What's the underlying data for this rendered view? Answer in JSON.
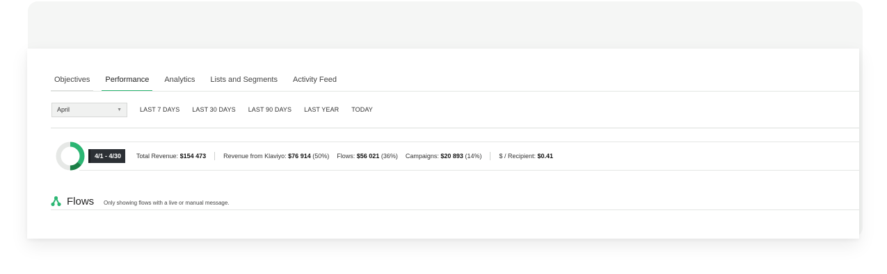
{
  "tabs": [
    {
      "label": "Objectives",
      "active": false
    },
    {
      "label": "Performance",
      "active": true
    },
    {
      "label": "Analytics",
      "active": false
    },
    {
      "label": "Lists and Segments",
      "active": false
    },
    {
      "label": "Activity Feed",
      "active": false
    }
  ],
  "filter": {
    "selected_period": "April",
    "ranges": [
      "LAST 7 DAYS",
      "LAST 30 DAYS",
      "LAST 90 DAYS",
      "LAST YEAR",
      "TODAY"
    ]
  },
  "summary": {
    "date_range": "4/1 - 4/30",
    "donut": {
      "klaviyo_share": 0.5,
      "flows_share": 0.36,
      "campaigns_share": 0.14
    },
    "total_revenue_label": "Total Revenue:",
    "total_revenue_value": "$154 473",
    "klaviyo_revenue_label": "Revenue from Klaviyo:",
    "klaviyo_revenue_value": "$76 914",
    "klaviyo_revenue_pct": "(50%)",
    "flows_label": "Flows:",
    "flows_value": "$56 021",
    "flows_pct": "(36%)",
    "campaigns_label": "Campaigns:",
    "campaigns_value": "$20 893",
    "campaigns_pct": "(14%)",
    "per_recipient_label": "$ / Recipient:",
    "per_recipient_value": "$0.41"
  },
  "flows": {
    "title": "Flows",
    "note": "Only showing flows with a live or manual message."
  },
  "colors": {
    "accent": "#2bb673",
    "accent_dark": "#1a7f46",
    "donut_track": "#e6e8e6"
  }
}
